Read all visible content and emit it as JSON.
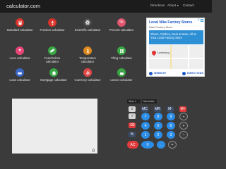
{
  "header": {
    "site_title": "calculator.com",
    "nav": [
      {
        "label": "Directions",
        "caret": false
      },
      {
        "label": "About",
        "caret": true
      },
      {
        "label": "Contact",
        "caret": false
      }
    ]
  },
  "calculators": [
    {
      "label": "Standard calculator",
      "icon": "calculator-icon",
      "color": "#d9342b"
    },
    {
      "label": "Fraction calculator",
      "icon": "fraction-icon",
      "color": "#d9342b"
    },
    {
      "label": "Scientific calculator",
      "icon": "scientific-icon",
      "color": "#4a4a4a"
    },
    {
      "label": "Percent calculator",
      "icon": "percent-icon",
      "color": "#e0556e"
    },
    {
      "label": "Love calculator",
      "icon": "heart-icon",
      "color": "#e54577"
    },
    {
      "label": "Feet/Inches calculator",
      "icon": "ruler-icon",
      "color": "#3aa845"
    },
    {
      "label": "Temperature calculator",
      "icon": "thermometer-icon",
      "color": "#e08a1e"
    },
    {
      "label": "Tiling calculator",
      "icon": "tiles-icon",
      "color": "#3aa845"
    },
    {
      "label": "Loan calculator",
      "icon": "loan-icon",
      "color": "#3a67c8"
    },
    {
      "label": "Mortgage calculator",
      "icon": "house-icon",
      "color": "#3aa845"
    },
    {
      "label": "Currency calculator",
      "icon": "currency-icon",
      "color": "#e04848"
    },
    {
      "label": "Leave calculator",
      "icon": "leave-icon",
      "color": "#3aa845"
    }
  ],
  "ad": {
    "title": "Local Nike Factory Stores",
    "subtitle": "Nike Factory Store",
    "banner": "Shoes, Clothes, Gear & More, All at Your Local Factory Store",
    "place": "Leesburg",
    "website_label": "WEBSITE",
    "directions_label": "DIRECTIONS",
    "close": "✕",
    "info": "i"
  },
  "calculator": {
    "display_value": "0",
    "view_select": "View",
    "mode_select": "Memories",
    "keys": {
      "row1": [
        "±",
        "MC",
        "MR",
        "M-",
        "M+"
      ],
      "row2": [
        "√",
        "7",
        "8",
        "9",
        "÷"
      ],
      "row3": [
        "⌫",
        "4",
        "5",
        "6",
        "×"
      ],
      "row4": [
        "%",
        "1",
        "2",
        "3",
        "−"
      ],
      "row5": [
        "AC",
        "0",
        ".",
        "+"
      ]
    }
  },
  "colors": {
    "background": "#3b3b3b",
    "header": "#1c1c1c",
    "key_blue": "#2d8ee8",
    "key_red": "#e23b3b",
    "key_navy": "#3d4c67"
  }
}
